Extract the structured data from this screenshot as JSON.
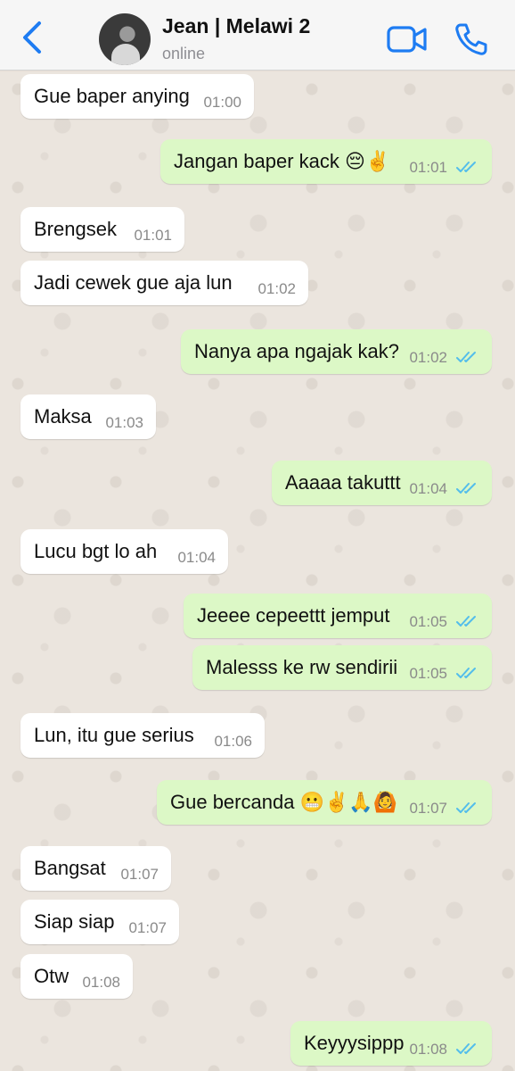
{
  "header": {
    "contact_name": "Jean | Melawi 2",
    "status": "online"
  },
  "colors": {
    "accent": "#1e7cf2",
    "incoming_bubble": "#ffffff",
    "outgoing_bubble": "#dcf8c6",
    "read_ticks": "#53bdeb"
  },
  "messages": [
    {
      "direction": "in",
      "text": "Gue baper anying",
      "time": "01:00"
    },
    {
      "direction": "out",
      "text": "Jangan baper kack 😔✌️",
      "time": "01:01",
      "status": "read"
    },
    {
      "direction": "in",
      "text": "Brengsek",
      "time": "01:01"
    },
    {
      "direction": "in",
      "text": "Jadi cewek gue aja lun",
      "time": "01:02"
    },
    {
      "direction": "out",
      "text": "Nanya apa ngajak kak?",
      "time": "01:02",
      "status": "read"
    },
    {
      "direction": "in",
      "text": "Maksa",
      "time": "01:03"
    },
    {
      "direction": "out",
      "text": "Aaaaa takuttt",
      "time": "01:04",
      "status": "read"
    },
    {
      "direction": "in",
      "text": "Lucu bgt lo ah",
      "time": "01:04"
    },
    {
      "direction": "out",
      "text": "Jeeee cepeettt jemput",
      "time": "01:05",
      "status": "read"
    },
    {
      "direction": "out",
      "text": "Malesss ke rw sendirii",
      "time": "01:05",
      "status": "read"
    },
    {
      "direction": "in",
      "text": "Lun, itu gue serius",
      "time": "01:06"
    },
    {
      "direction": "out",
      "text": "Gue bercanda 😬✌️🙏🙆",
      "time": "01:07",
      "status": "read"
    },
    {
      "direction": "in",
      "text": "Bangsat",
      "time": "01:07"
    },
    {
      "direction": "in",
      "text": "Siap siap",
      "time": "01:07"
    },
    {
      "direction": "in",
      "text": "Otw",
      "time": "01:08"
    },
    {
      "direction": "out",
      "text": "Keyyysippp",
      "time": "01:08",
      "status": "read"
    }
  ]
}
